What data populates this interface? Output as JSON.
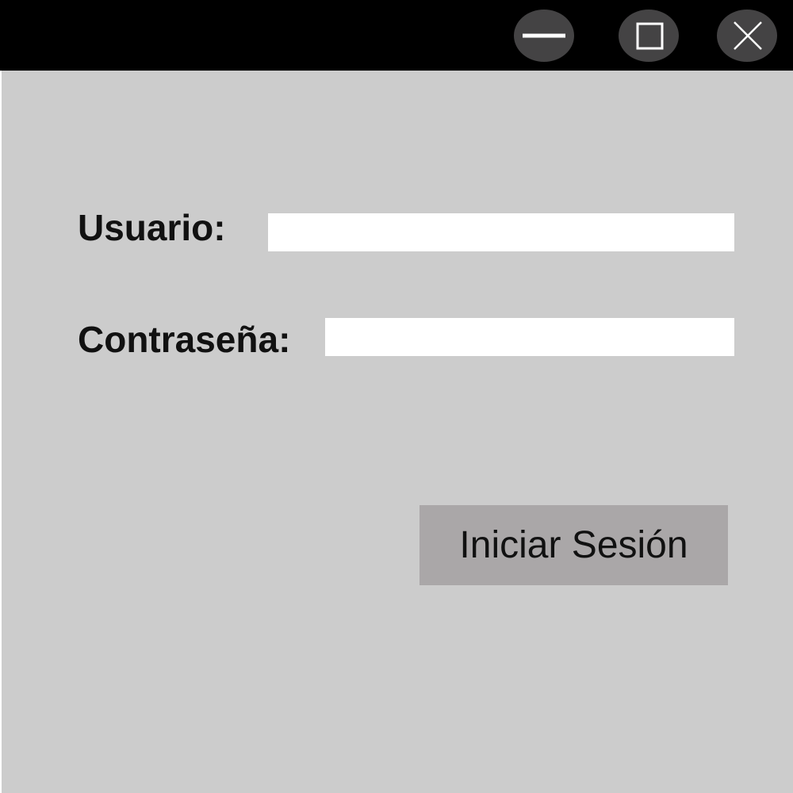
{
  "titlebar": {
    "controls": [
      {
        "id": "minimize",
        "icon": "minimize-icon"
      },
      {
        "id": "maximize",
        "icon": "maximize-icon"
      },
      {
        "id": "close",
        "icon": "close-icon"
      }
    ]
  },
  "form": {
    "username_label": "Usuario:",
    "username_value": "",
    "password_label": "Contraseña:",
    "password_value": "",
    "submit_label": "Iniciar Sesión"
  },
  "colors": {
    "titlebar": "#000000",
    "window_button": "#444344",
    "background": "#cccccc",
    "input": "#ffffff",
    "button": "#aaa7a8"
  }
}
